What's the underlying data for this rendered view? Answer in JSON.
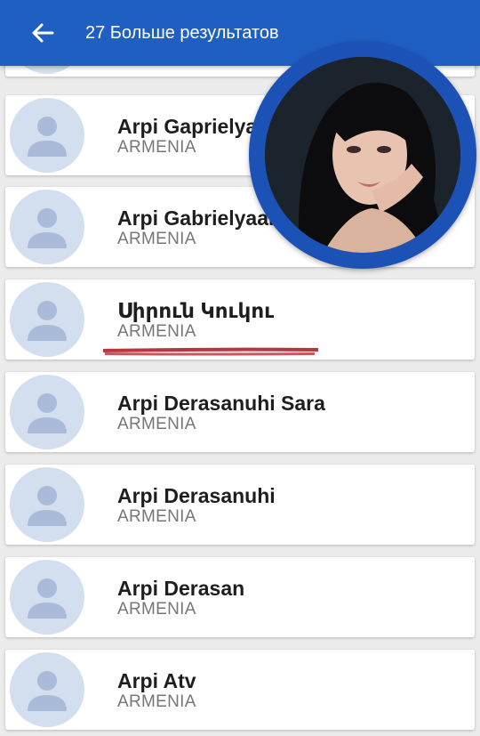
{
  "appbar": {
    "title": "27 Больше результатов",
    "back_icon": "arrow-left-icon"
  },
  "results": [
    {
      "name": "",
      "country": ""
    },
    {
      "name": "Arpi Gaprielyan",
      "country": "ARMENIA"
    },
    {
      "name": "Arpi Gabrielyaan",
      "country": "ARMENIA"
    },
    {
      "name": "Սիրուն Կուկու",
      "country": "ARMENIA"
    },
    {
      "name": "Arpi Derasanuhi Sara",
      "country": "ARMENIA"
    },
    {
      "name": "Arpi Derasanuhi",
      "country": "ARMENIA"
    },
    {
      "name": "Arpi Derasan",
      "country": "ARMENIA"
    },
    {
      "name": "Arpi Atv",
      "country": "ARMENIA"
    }
  ],
  "highlight": {
    "item_index": 3,
    "color": "#b0202a"
  },
  "colors": {
    "appbar": "#1f5fc2",
    "avatar_bg": "#d3deef",
    "avatar_fg": "#a9bbd8",
    "photo_ring": "#1c52b6"
  }
}
